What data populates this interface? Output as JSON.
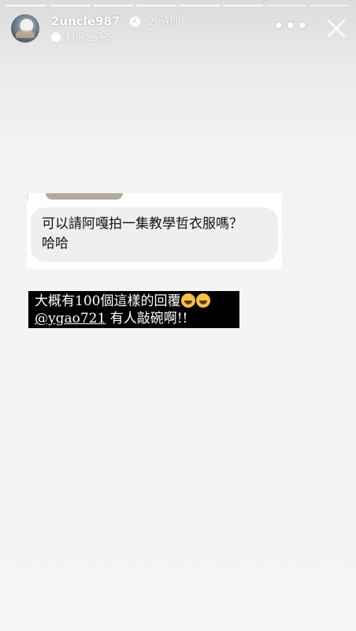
{
  "progress": {
    "total": 8,
    "completed": 6
  },
  "header": {
    "username": "2uncle987",
    "time_ago": "2 時間",
    "translate_label": "翻訳を見る",
    "more_icon": "more-horizontal-icon",
    "close_icon": "close-icon"
  },
  "reply_card": {
    "text_line1": "可以請阿嘎拍一集教學哲衣服嗎？",
    "text_line2": "哈哈"
  },
  "caption": {
    "line1_text": "大概有100個這樣的回覆",
    "line2_mention": "@ygao721",
    "line2_text": " 有人敲碗啊!!",
    "emoji": "rolling-on-floor-laughing"
  },
  "colors": {
    "caption_bg": "#000000",
    "card_bg": "#ffffff",
    "bubble_bg": "#efefef"
  }
}
